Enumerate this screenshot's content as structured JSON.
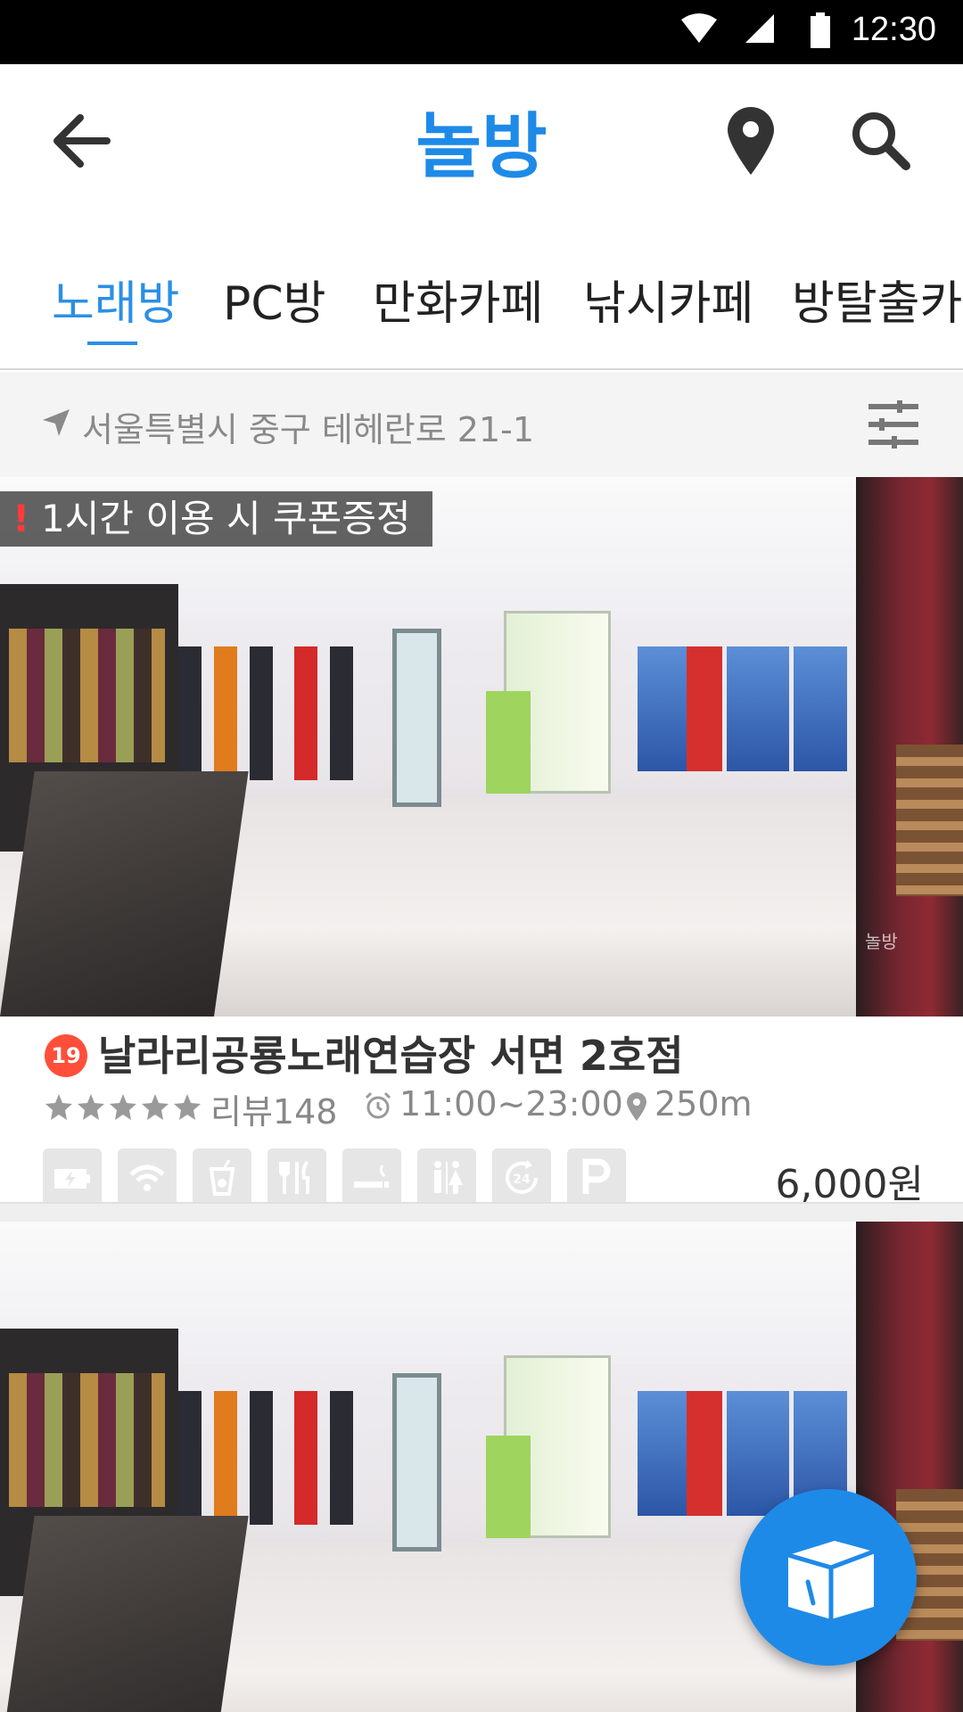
{
  "status_bar": {
    "time": "12:30"
  },
  "app_bar": {
    "title": "놀방"
  },
  "tabs": [
    {
      "label": "노래방",
      "active": true
    },
    {
      "label": "PC방",
      "active": false
    },
    {
      "label": "만화카페",
      "active": false
    },
    {
      "label": "낚시카페",
      "active": false
    },
    {
      "label": "방탈출카페",
      "active": false
    }
  ],
  "location": {
    "address": "서울특별시 중구 테헤란로 21-1"
  },
  "listings": [
    {
      "promo": "1시간 이용 시 쿠폰증정",
      "age_badge": "19",
      "name": "날라리공룡노래연습장 서면 2호점",
      "rating_stars": 5,
      "reviews": "리뷰148",
      "hours": "11:00~23:00",
      "distance": "250m",
      "price": "6,000원",
      "watermark": "놀방",
      "amenities": [
        "battery-icon",
        "wifi-icon",
        "drink-icon",
        "food-icon",
        "smoking-icon",
        "restroom-icon",
        "24h-icon",
        "parking-icon"
      ]
    }
  ],
  "colors": {
    "brand": "#1e8ae8",
    "age_badge": "#ff4f3b",
    "promo_mark": "#ff3b3b"
  }
}
